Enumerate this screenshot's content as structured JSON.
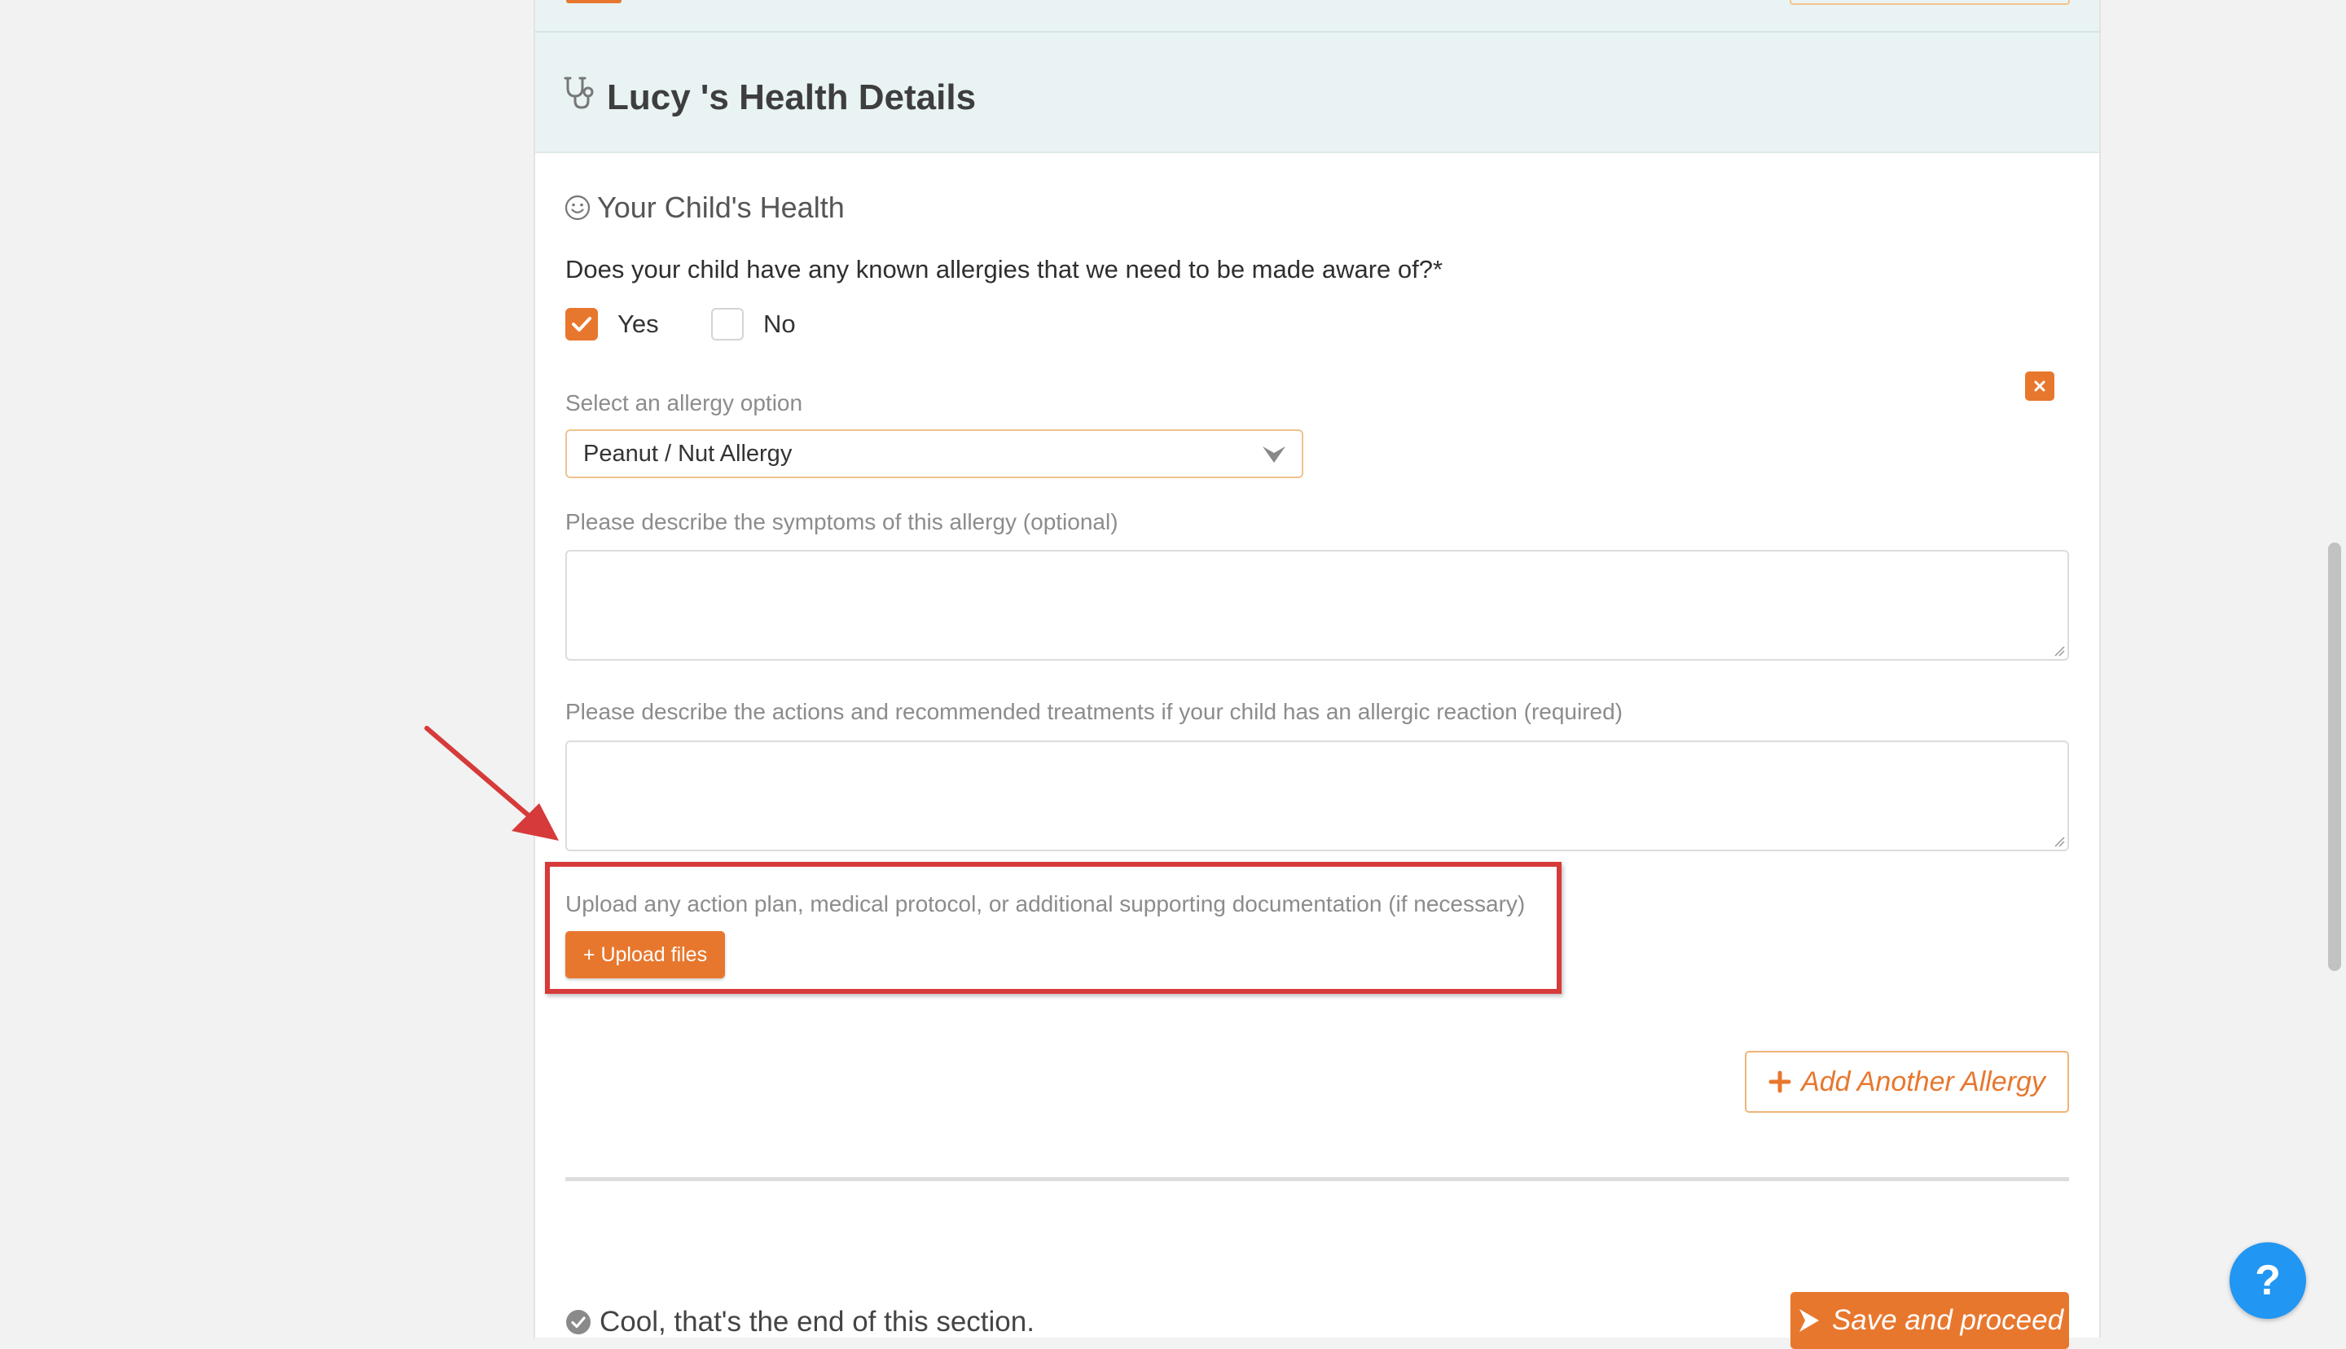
{
  "header": {
    "title": "Lucy 's Health Details",
    "icon": "stethoscope-icon"
  },
  "health": {
    "subheading": "Your Child's Health",
    "subheading_icon": "smiley-icon",
    "allergy_question": "Does your child have any known allergies that we need to be made aware of?*",
    "options": {
      "yes": {
        "label": "Yes",
        "checked": true
      },
      "no": {
        "label": "No",
        "checked": false
      }
    }
  },
  "allergy": {
    "select_label": "Select an allergy option",
    "selected_value": "Peanut / Nut Allergy",
    "symptoms_label": "Please describe the symptoms of this allergy (optional)",
    "symptoms_value": "",
    "treatment_label": "Please describe the actions and recommended treatments if your child has an allergic reaction (required)",
    "treatment_value": "",
    "upload_label": "Upload any action plan, medical protocol, or additional supporting documentation (if necessary)",
    "upload_button": "+ Upload files",
    "add_another_button": "Add Another Allergy"
  },
  "footer": {
    "end_note": "Cool, that's the end of this section.",
    "save_button": "Save and proceed"
  },
  "help": {
    "label": "?"
  },
  "colors": {
    "accent_orange": "#e8772e",
    "header_bg": "#e9f3f3",
    "annotation_red": "#d63a3a",
    "help_blue": "#2196f3"
  }
}
